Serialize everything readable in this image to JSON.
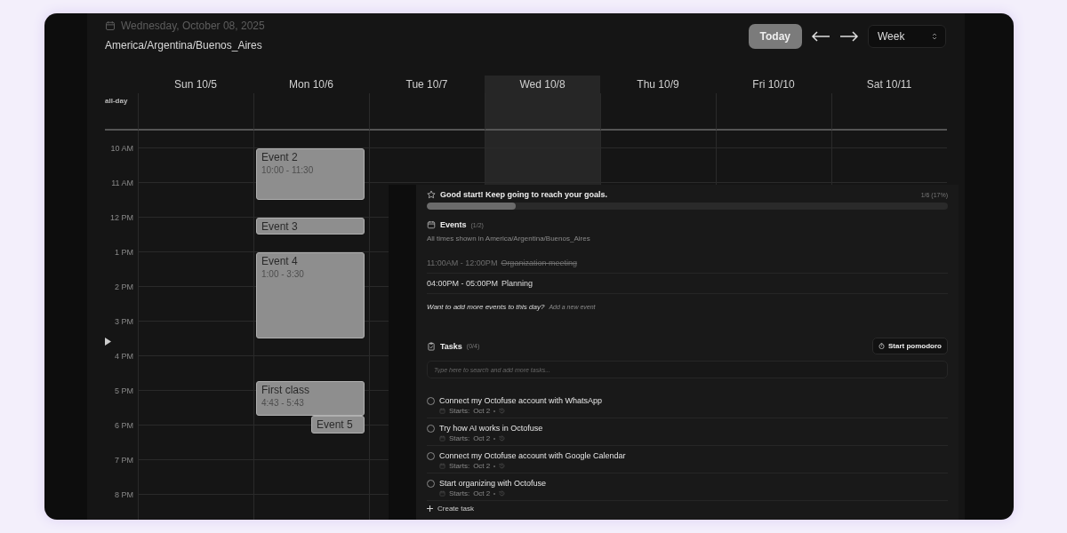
{
  "header": {
    "date": "Wednesday, October 08, 2025",
    "timezone": "America/Argentina/Buenos_Aires",
    "today_button": "Today",
    "view_select": "Week"
  },
  "all_day_label": "all-day",
  "hours": [
    "10 AM",
    "11 AM",
    "12 PM",
    "1 PM",
    "2 PM",
    "3 PM",
    "4 PM",
    "5 PM",
    "6 PM",
    "7 PM",
    "8 PM"
  ],
  "days": [
    {
      "label": "Sun 10/5",
      "selected": false
    },
    {
      "label": "Mon 10/6",
      "selected": false,
      "events": [
        {
          "title": "Event 2",
          "time": "10:00 - 11:30"
        },
        {
          "title": "Event 3"
        },
        {
          "title": "Event 4",
          "time": "1:00 - 3:30"
        },
        {
          "title": "First class",
          "time": "4:43 - 5:43"
        },
        {
          "title": "Event 5"
        }
      ]
    },
    {
      "label": "Tue 10/7",
      "selected": false
    },
    {
      "label": "Wed 10/8",
      "selected": true
    },
    {
      "label": "Thu 10/9",
      "selected": false
    },
    {
      "label": "Fri 10/10",
      "selected": false
    },
    {
      "label": "Sat 10/11",
      "selected": false
    }
  ],
  "panel": {
    "goal": {
      "message": "Good start! Keep going to reach your goals.",
      "count": "1/6 (17%)",
      "level": 0.17
    },
    "events": {
      "title": "Events",
      "count": "(1/2)",
      "note": "All times shown in America/Argentina/Buenos_Aires",
      "items": [
        {
          "time": "11:00AM - 12:00PM",
          "title": "Organization meeting",
          "done": true
        },
        {
          "time": "04:00PM - 05:00PM",
          "title": "Planning",
          "done": false
        }
      ],
      "prompt": "Want to add more events to this day?",
      "add_link": "Add a new event"
    },
    "tasks": {
      "title": "Tasks",
      "count": "(0/4)",
      "pomodoro_button": "Start pomodoro",
      "placeholder": "Type here to search and add more tasks...",
      "items": [
        {
          "title": "Connect my Octofuse account with WhatsApp",
          "starts_label": "Starts:",
          "date": "Oct 2",
          "checked": false
        },
        {
          "title": "Try how AI works in Octofuse",
          "starts_label": "Starts:",
          "date": "Oct 2",
          "checked": false
        },
        {
          "title": "Connect my Octofuse account with Google Calendar",
          "starts_label": "Starts:",
          "date": "Oct 2",
          "checked": false
        },
        {
          "title": "Start organizing with Octofuse",
          "starts_label": "Starts:",
          "date": "Oct 2",
          "checked": false
        }
      ],
      "create": "Create task"
    }
  }
}
